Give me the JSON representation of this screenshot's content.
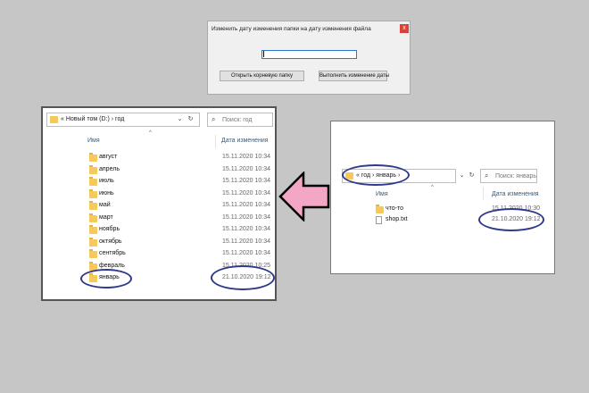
{
  "dialog": {
    "title": "Изменить дату изменения папки на дату изменения файла",
    "close_glyph": "x",
    "input_value": "",
    "btn_open_root": "Открыть корневую папку",
    "btn_apply": "Выполнить изменение даты"
  },
  "left_explorer": {
    "breadcrumb": "«  Новый том (D:)  ›  год",
    "search_placeholder": "Поиск: год",
    "column_name": "Имя",
    "column_date": "Дата изменения",
    "rows": [
      {
        "name": "август",
        "date": "15.11.2020 10:34"
      },
      {
        "name": "апрель",
        "date": "15.11.2020 10:34"
      },
      {
        "name": "июль",
        "date": "15.11.2020 10:34"
      },
      {
        "name": "июнь",
        "date": "15.11.2020 10:34"
      },
      {
        "name": "май",
        "date": "15.11.2020 10:34"
      },
      {
        "name": "март",
        "date": "15.11.2020 10:34"
      },
      {
        "name": "ноябрь",
        "date": "15.11.2020 10:34"
      },
      {
        "name": "октябрь",
        "date": "15.11.2020 10:34"
      },
      {
        "name": "сентябрь",
        "date": "15.11.2020 10:34"
      },
      {
        "name": "февраль",
        "date": "15.11.2020 10:25"
      },
      {
        "name": "январь",
        "date": "21.10.2020 19:12"
      }
    ]
  },
  "right_explorer": {
    "breadcrumb": "«  год  ›  январь  ›",
    "search_placeholder": "Поиск: январь",
    "column_name": "Имя",
    "column_date": "Дата изменения",
    "rows": [
      {
        "name": "что-то",
        "date": "15.11.2020 10:30",
        "icon": "folder-icon"
      },
      {
        "name": "shop.txt",
        "date": "21.10.2020 19:12",
        "icon": "text-file-icon"
      }
    ]
  },
  "colors": {
    "background": "#c6c6c6",
    "arrow_fill": "#f4a6c6",
    "ellipse_stroke": "#303a8c",
    "folder": "#f5c95b",
    "close_button": "#d9413a"
  },
  "icons": {
    "refresh": "↻",
    "dropdown": "⌄",
    "search": "⌕",
    "sort_up": "^"
  }
}
